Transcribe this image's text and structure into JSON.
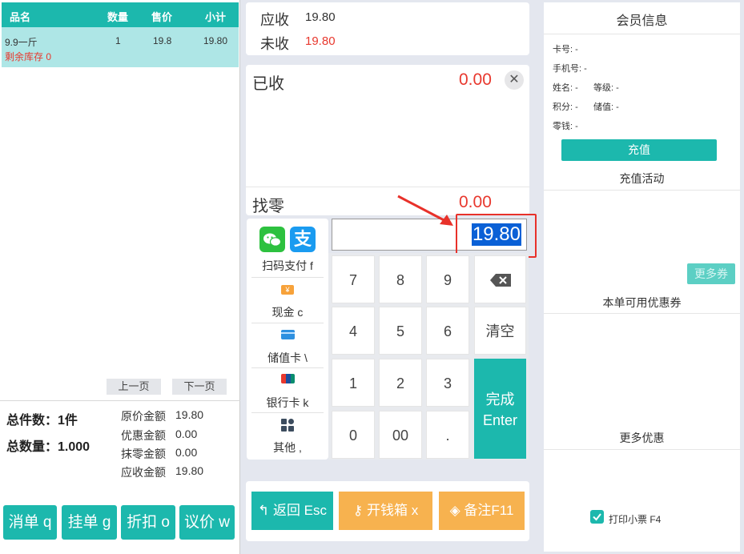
{
  "cart": {
    "headers": {
      "name": "品名",
      "qty": "数量",
      "price": "售价",
      "subtotal": "小计"
    },
    "items": [
      {
        "name": "9.9一斤",
        "qty": "1",
        "price": "19.8",
        "subtotal": "19.80",
        "stock": "剩余库存 0"
      }
    ],
    "prev_page": "上一页",
    "next_page": "下一页"
  },
  "summary": {
    "total_items": "总件数：1件",
    "total_qty": "总数量：1.000",
    "original_label": "原价金额",
    "original_value": "19.80",
    "discount_label": "优惠金额",
    "discount_value": "0.00",
    "rounding_label": "抹零金额",
    "rounding_value": "0.00",
    "receivable_label": "应收金额",
    "receivable_value": "19.80"
  },
  "left_buttons": {
    "void": "消单 q",
    "hold": "挂单 g",
    "discount": "折扣 o",
    "bargain": "议价 w"
  },
  "payment": {
    "receivable_label": "应收",
    "receivable_value": "19.80",
    "unpaid_label": "未收",
    "unpaid_value": "19.80",
    "received_label": "已收",
    "received_value": "0.00",
    "change_label": "找零",
    "change_value": "0.00",
    "input_value": "19.80"
  },
  "pay_methods": {
    "scan": "扫码支付 f",
    "cash": "现金 c",
    "stored_card": "储值卡 \\",
    "bank_card": "银行卡 k",
    "other": "其他 ,"
  },
  "keypad": {
    "k7": "7",
    "k8": "8",
    "k9": "9",
    "clear": "清空",
    "k4": "4",
    "k5": "5",
    "k6": "6",
    "k1": "1",
    "k2": "2",
    "k3": "3",
    "k0": "0",
    "k00": "00",
    "dot": ".",
    "done": "完成",
    "done_key": "Enter"
  },
  "bottom_buttons": {
    "back": "返回 Esc",
    "cash_drawer": "开钱箱 x",
    "remark": "备注F11"
  },
  "member": {
    "title": "会员信息",
    "card_no": "卡号: -",
    "phone": "手机号: -",
    "name": "姓名: -",
    "level": "等级: -",
    "points": "积分: -",
    "balance": "储值: -",
    "small_change": "零钱: -",
    "recharge": "充值",
    "recharge_activity": "充值活动",
    "more_coupons": "更多券",
    "available_coupons": "本单可用优惠券",
    "more_offers": "更多优惠",
    "print_receipt": "打印小票 F4"
  },
  "colors": {
    "teal": "#1cb8ad",
    "orange": "#f7b24f",
    "red": "#e8382e",
    "highlight": "#0a60d6"
  }
}
